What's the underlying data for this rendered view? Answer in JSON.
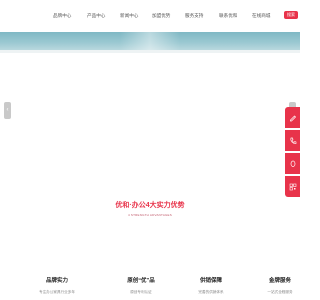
{
  "nav": {
    "items": [
      "品牌中心",
      "产品中心",
      "新闻中心",
      "加盟优势",
      "服务支持",
      "联系优和",
      "在线商城"
    ],
    "search_label": "搜索"
  },
  "slider": {
    "prev_label": "‹",
    "next_label": "›"
  },
  "sidebar": {
    "items": [
      {
        "icon": "edit-icon"
      },
      {
        "icon": "phone-icon"
      },
      {
        "icon": "message-icon"
      },
      {
        "icon": "qrcode-icon"
      }
    ]
  },
  "promo": {
    "title": "优和·办公4大实力优势",
    "subtitle": "4 STRENGTH ADVANTAGES"
  },
  "features": [
    {
      "title": "品牌实力",
      "desc": "专注办公家具行业多年"
    },
    {
      "title": "原创“优”品",
      "desc": "原创专利认证"
    },
    {
      "title": "供销保障",
      "desc": "完善的供销体系"
    },
    {
      "title": "金牌服务",
      "desc": "一站式全程服务"
    }
  ],
  "colors": {
    "brand": "#e8334a",
    "banner": "#8fc1cb",
    "arrow": "#c9c9c9"
  }
}
